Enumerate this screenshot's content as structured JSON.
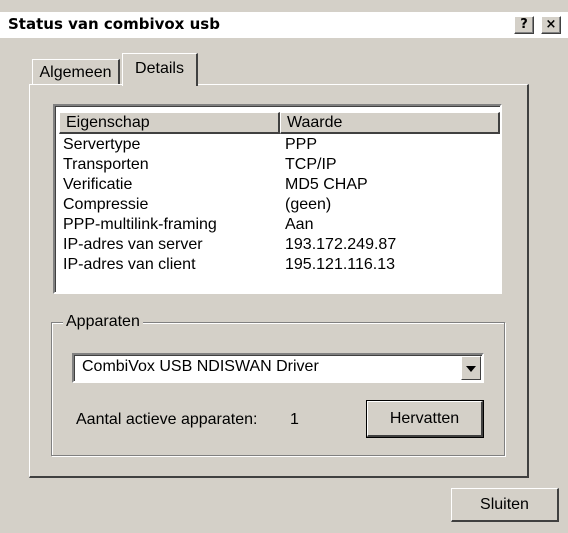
{
  "window": {
    "title": "Status van combivox usb",
    "help_button": "?",
    "close_button": "×"
  },
  "tabs": [
    {
      "label": "Algemeen"
    },
    {
      "label": "Details"
    }
  ],
  "details": {
    "columns": [
      "Eigenschap",
      "Waarde"
    ],
    "rows": [
      {
        "property": "Servertype",
        "value": "PPP"
      },
      {
        "property": "Transporten",
        "value": "TCP/IP"
      },
      {
        "property": "Verificatie",
        "value": "MD5 CHAP"
      },
      {
        "property": "Compressie",
        "value": "(geen)"
      },
      {
        "property": "PPP-multilink-framing",
        "value": "Aan"
      },
      {
        "property": "IP-adres van server",
        "value": "193.172.249.87"
      },
      {
        "property": "IP-adres van client",
        "value": "195.121.116.13"
      }
    ]
  },
  "devices": {
    "group_label": "Apparaten",
    "selected_device": "CombiVox USB NDISWAN Driver",
    "active_count_label": "Aantal actieve apparaten:",
    "active_count": "1",
    "resume_button": "Hervatten"
  },
  "footer": {
    "close_label": "Sluiten"
  }
}
